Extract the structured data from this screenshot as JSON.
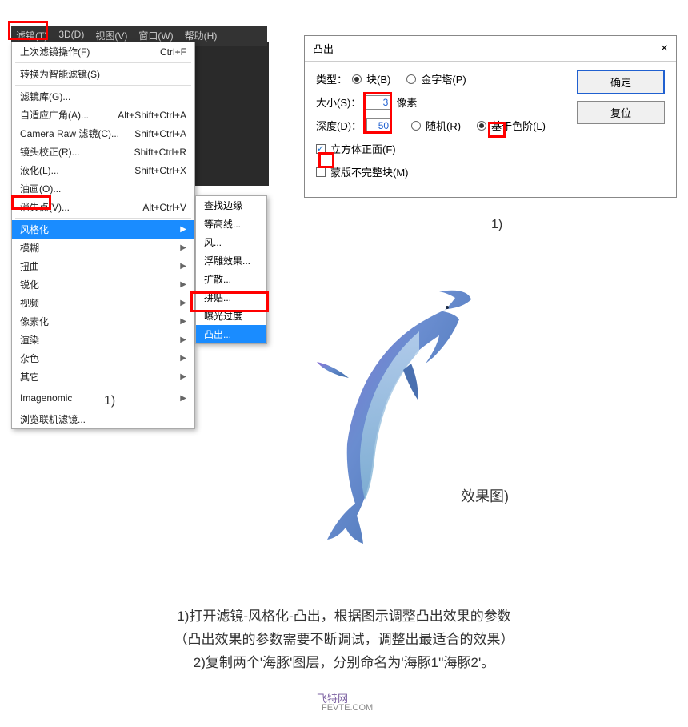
{
  "menubar": {
    "filter": "滤镜(T)",
    "threed": "3D(D)",
    "view": "视图(V)",
    "window": "窗口(W)",
    "help": "帮助(H)"
  },
  "dropdown": {
    "last_filter": "上次滤镜操作(F)",
    "last_filter_shortcut": "Ctrl+F",
    "smart": "转换为智能滤镜(S)",
    "gallery": "滤镜库(G)...",
    "adaptive": "自适应广角(A)...",
    "adaptive_shortcut": "Alt+Shift+Ctrl+A",
    "camera_raw": "Camera Raw 滤镜(C)...",
    "camera_raw_shortcut": "Shift+Ctrl+A",
    "lens": "镜头校正(R)...",
    "lens_shortcut": "Shift+Ctrl+R",
    "liquify": "液化(L)...",
    "liquify_shortcut": "Shift+Ctrl+X",
    "oil": "油画(O)...",
    "vanish": "消失点(V)...",
    "vanish_shortcut": "Alt+Ctrl+V",
    "stylize": "风格化",
    "blur": "模糊",
    "distort": "扭曲",
    "sharpen": "锐化",
    "video": "视频",
    "pixelate": "像素化",
    "render": "渲染",
    "noise": "杂色",
    "other": "其它",
    "imagenomic": "Imagenomic",
    "browse": "浏览联机滤镜..."
  },
  "submenu": {
    "find_edges": "查找边缘",
    "contour": "等高线...",
    "wind": "风...",
    "emboss": "浮雕效果...",
    "diffuse": "扩散...",
    "tiles": "拼贴...",
    "solarize": "曝光过度",
    "extrude": "凸出..."
  },
  "label1a": "1)",
  "dialog": {
    "title": "凸出",
    "type_label": "类型：",
    "type_block": "块(B)",
    "type_pyramid": "金字塔(P)",
    "size_label": "大小(S)：",
    "size_value": "3",
    "size_unit": "像素",
    "depth_label": "深度(D)：",
    "depth_value": "50",
    "random": "随机(R)",
    "level_based": "基于色阶(L)",
    "cube_front": "立方体正面(F)",
    "mask_incomplete": "蒙版不完整块(M)",
    "ok": "确定",
    "reset": "复位"
  },
  "label1b": "1)",
  "effect_label": "效果图)",
  "instructions": {
    "line1": "1)打开滤镜-风格化-凸出，根据图示调整凸出效果的参数",
    "line2": "（凸出效果的参数需要不断调试，调整出最适合的效果）",
    "line3": "2)复制两个'海豚'图层，分别命名为'海豚1''海豚2'。"
  },
  "watermark": "飞特网",
  "watermark2": "FEVTE.COM"
}
